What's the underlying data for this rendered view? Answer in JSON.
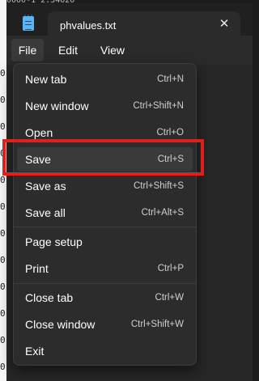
{
  "background_editor": {
    "top_line_text": "0000-1 2.34020",
    "left_line_fragment": "0"
  },
  "window": {
    "tab_title": "phvalues.txt",
    "tab_close_glyph": "✕",
    "app_icon": "notepad-icon"
  },
  "menubar": {
    "items": [
      {
        "label": "File",
        "active": true
      },
      {
        "label": "Edit",
        "active": false
      },
      {
        "label": "View",
        "active": false
      }
    ]
  },
  "file_menu": {
    "items": [
      {
        "label": "New tab",
        "shortcut": "Ctrl+N"
      },
      {
        "label": "New window",
        "shortcut": "Ctrl+Shift+N"
      },
      {
        "label": "Open",
        "shortcut": "Ctrl+O"
      },
      {
        "label": "Save",
        "shortcut": "Ctrl+S",
        "highlighted": true
      },
      {
        "label": "Save as",
        "shortcut": "Ctrl+Shift+S"
      },
      {
        "label": "Save all",
        "shortcut": "Ctrl+Alt+S"
      },
      {
        "label": "Page setup",
        "shortcut": ""
      },
      {
        "label": "Print",
        "shortcut": "Ctrl+P"
      },
      {
        "label": "Close tab",
        "shortcut": "Ctrl+W"
      },
      {
        "label": "Close window",
        "shortcut": "Ctrl+Shift+W"
      },
      {
        "label": "Exit",
        "shortcut": ""
      }
    ]
  },
  "colors": {
    "highlight_box": "#e0201a",
    "app_icon": "#5ab4f5"
  }
}
